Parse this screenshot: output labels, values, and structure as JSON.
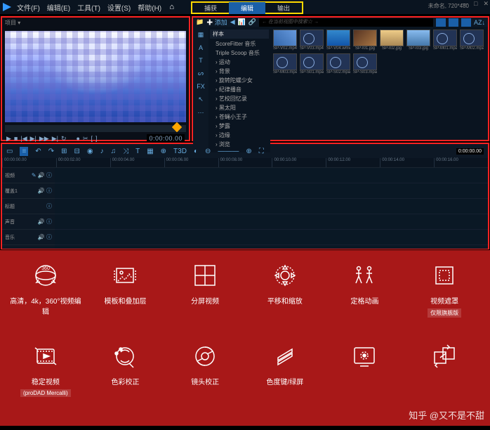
{
  "menu": {
    "file": "文件(F)",
    "edit": "编辑(E)",
    "tools": "工具(T)",
    "settings": "设置(S)",
    "help": "帮助(H)"
  },
  "status": {
    "filename": "未命名, 720*480"
  },
  "tabs": {
    "capture": "捕获",
    "edit": "编辑",
    "output": "输出"
  },
  "preview": {
    "title": "项目 ▾",
    "timecode": "0:00:00.00"
  },
  "pv_ctrl": {
    "play": "▶",
    "stop": "■",
    "prev": "|◀",
    "ff": "▶|",
    "next": "▶▶",
    "end": "▶|",
    "rec": "●",
    "loop": "↻",
    "split": "✂",
    "mark_in": "[",
    "mark_out": "]"
  },
  "library": {
    "add": "添加",
    "search_ph": "← 在当前视图中搜索☆ →",
    "sort": "AZ↓",
    "side": [
      "▦",
      "A",
      "T",
      "ᔕ",
      "FX",
      "↖",
      "⋯"
    ],
    "cats_header": "样本",
    "cats": [
      "ScoreFitter 音乐",
      "Triple Scoop 音乐",
      "运动",
      "背景",
      "旋转陀螺少女",
      "纪律播音",
      "艺校回忆录",
      "黑太阳",
      "苍蝇小王子",
      "梦露",
      "边缘",
      "浏览"
    ],
    "thumbs": [
      {
        "cls": "t1",
        "name": "SP-V02.mp4"
      },
      {
        "cls": "t2",
        "name": "SP-V03.mp4"
      },
      {
        "cls": "t3",
        "name": "SP-V04.wmv"
      },
      {
        "cls": "t4",
        "name": "SP-I01.jpg"
      },
      {
        "cls": "t5",
        "name": "SP-I02.jpg"
      },
      {
        "cls": "t6",
        "name": "SP-I03.jpg"
      },
      {
        "cls": "t2",
        "name": "SP-M01.mpa"
      },
      {
        "cls": "t2",
        "name": "SP-M02.mpa"
      },
      {
        "cls": "t2",
        "name": "SP-M03.mpa"
      },
      {
        "cls": "t2",
        "name": "SP-S01.mpa"
      },
      {
        "cls": "t2",
        "name": "SP-S02.mpa"
      },
      {
        "cls": "t2",
        "name": "SP-S03.mpa"
      }
    ]
  },
  "timeline": {
    "timecode": "0:00:00.00",
    "ruler": [
      "00:00:00.00",
      "00:00:02.00",
      "00:00:04.00",
      "00:00:06.00",
      "00:00:08.00",
      "00:00:10.00",
      "00:00:12.00",
      "00:00:14.00",
      "00:00:16.00"
    ],
    "tracks": [
      {
        "name": "视频",
        "icons": "✎ 🔊 ⓘ"
      },
      {
        "name": "覆盖1",
        "icons": "🔊 ⓘ"
      },
      {
        "name": "标题",
        "icons": "ⓘ"
      },
      {
        "name": "声音",
        "icons": "🔊 ⓘ"
      },
      {
        "name": "音乐",
        "icons": "🔊 ⓘ"
      }
    ]
  },
  "features": {
    "row1": [
      {
        "label": "高清，4k，360°视频编辑"
      },
      {
        "label": "模板和叠加层"
      },
      {
        "label": "分屏视频"
      },
      {
        "label": "平移和缩放"
      },
      {
        "label": "定格动画"
      },
      {
        "label": "视频遮罩",
        "sub": "仅限旗舰版"
      }
    ],
    "row2": [
      {
        "label": "稳定视频",
        "sub": "(proDAD Mercalli)"
      },
      {
        "label": "色彩校正"
      },
      {
        "label": "镜头校正"
      },
      {
        "label": "色度键/绿屏"
      },
      {
        "label": "",
        "sub": ""
      },
      {
        "label": "",
        "sub": ""
      }
    ],
    "watermark": "知乎 @又不是不甜"
  }
}
